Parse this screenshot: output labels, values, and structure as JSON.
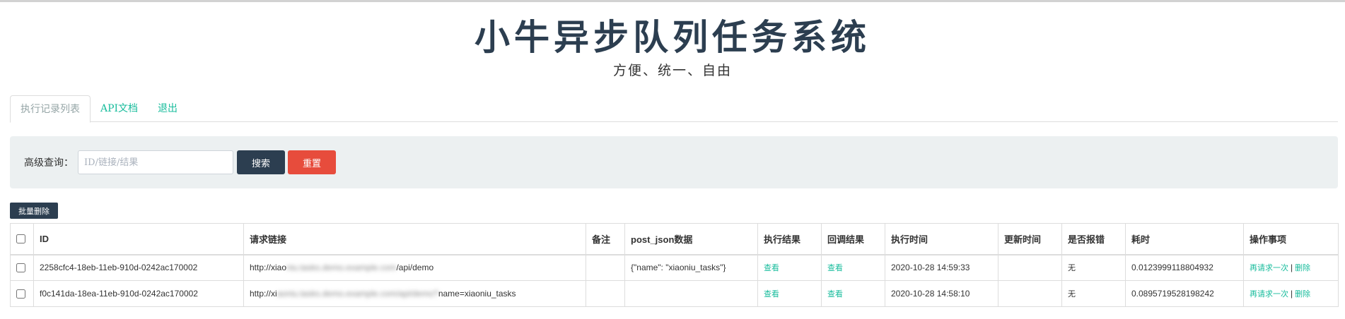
{
  "header": {
    "title": "小牛异步队列任务系统",
    "subtitle": "方便、统一、自由"
  },
  "tabs": [
    {
      "label": "执行记录列表",
      "active": true
    },
    {
      "label": "API文档",
      "active": false
    },
    {
      "label": "退出",
      "active": false
    }
  ],
  "search": {
    "label": "高级查询：",
    "placeholder": "ID/链接/结果",
    "value": "",
    "search_label": "搜索",
    "reset_label": "重置"
  },
  "bulk_delete_label": "批量删除",
  "table": {
    "columns": [
      "ID",
      "请求链接",
      "备注",
      "post_json数据",
      "执行结果",
      "回调结果",
      "执行时间",
      "更新时间",
      "是否报错",
      "耗时",
      "操作事项"
    ],
    "rows": [
      {
        "id": "2258cfc4-18eb-11eb-910d-0242ac170002",
        "url_start": "http://xiao",
        "url_hidden": "niu.tasks.demo.example.com",
        "url_end": "/api/demo",
        "remark": "",
        "post_json": "{\"name\": \"xiaoniu_tasks\"}",
        "exec_result": "查看",
        "callback_result": "查看",
        "exec_time": "2020-10-28 14:59:33",
        "update_time": "",
        "is_error": "无",
        "duration": "0.0123999118804932",
        "retry": "再请求一次",
        "delete": "删除"
      },
      {
        "id": "f0c141da-18ea-11eb-910d-0242ac170002",
        "url_start": "http://xi",
        "url_hidden": "aoniu.tasks.demo.example.com/api/demo?",
        "url_end": "name=xiaoniu_tasks",
        "remark": "",
        "post_json": "",
        "exec_result": "查看",
        "callback_result": "查看",
        "exec_time": "2020-10-28 14:58:10",
        "update_time": "",
        "is_error": "无",
        "duration": "0.0895719528198242",
        "retry": "再请求一次",
        "delete": "删除"
      }
    ],
    "separator": "|"
  }
}
